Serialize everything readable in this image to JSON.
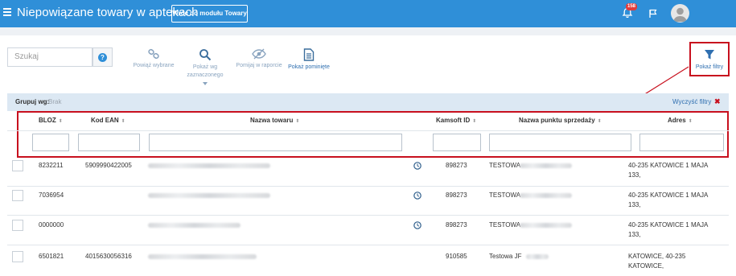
{
  "header": {
    "title": "Niepowiązane towary w aptekach",
    "back_button": "Wróć do modułu Towary",
    "notification_count": "158"
  },
  "toolbar": {
    "search_placeholder": "Szukaj",
    "help_label": "?",
    "link_selected": "Powiąż wybrane",
    "show_by_selected_line1": "Pokaż wg",
    "show_by_selected_line2": "zaznaczonego",
    "ignore_in_report": "Pomijaj w raporcie",
    "show_skipped": "Pokaż pominięte",
    "show_filters": "Pokaż filtry"
  },
  "groupbar": {
    "label": "Grupuj wg:",
    "value": "Brak",
    "clear_filters": "Wyczyść filtry",
    "clear_icon": "✖"
  },
  "table": {
    "columns": [
      "BLOZ",
      "Kod EAN",
      "Nazwa towaru",
      "Kamsoft ID",
      "Nazwa punktu sprzedaży",
      "Adres"
    ],
    "sort_glyph": "⬍",
    "rows": [
      {
        "bloz": "8232211",
        "ean": "5909990422005",
        "kamsoft_id": "898273",
        "point_name": "TESTOWA",
        "address_line1": "40-235 KATOWICE 1 MAJA",
        "address_line2": "133,"
      },
      {
        "bloz": "7036954",
        "ean": "",
        "kamsoft_id": "898273",
        "point_name": "TESTOWA",
        "address_line1": "40-235 KATOWICE 1 MAJA",
        "address_line2": "133,"
      },
      {
        "bloz": "0000000",
        "ean": "",
        "kamsoft_id": "898273",
        "point_name": "TESTOWA",
        "address_line1": "40-235 KATOWICE 1 MAJA",
        "address_line2": "133,"
      },
      {
        "bloz": "6501821",
        "ean": "4015630056316",
        "kamsoft_id": "910585",
        "point_name": "Testowa JF",
        "address_line1": "KATOWICE, 40-235",
        "address_line2": "KATOWICE,"
      }
    ]
  },
  "icons": {
    "menu": "hamburger-icon",
    "notifications": "bell-icon",
    "flag": "flag-icon",
    "user": "user-avatar-icon",
    "link": "link-icon",
    "search": "magnifier-icon",
    "hide": "eye-slash-icon",
    "document": "document-icon",
    "filter": "funnel-icon",
    "clock": "clock-icon"
  },
  "colors": {
    "topbar": "#2f8fd8",
    "highlight": "#c8101e",
    "link": "#2f6fb0",
    "group_bar": "#dce8f3"
  }
}
